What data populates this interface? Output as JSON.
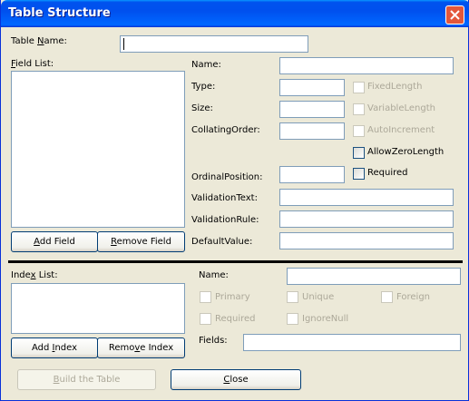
{
  "window": {
    "title": "Table Structure"
  },
  "table": {
    "name_label": "Table Name:",
    "name_value": ""
  },
  "field_list": {
    "label": "Field List:",
    "items": []
  },
  "field": {
    "name_label": "Name:",
    "name_value": "",
    "type_label": "Type:",
    "type_value": "",
    "size_label": "Size:",
    "size_value": "",
    "collating_label": "CollatingOrder:",
    "collating_value": "",
    "ordinal_label": "OrdinalPosition:",
    "ordinal_value": "",
    "validation_text_label": "ValidationText:",
    "validation_text_value": "",
    "validation_rule_label": "ValidationRule:",
    "validation_rule_value": "",
    "default_label": "DefaultValue:",
    "default_value": "",
    "fixed_length": "FixedLength",
    "variable_length": "VariableLength",
    "auto_increment": "AutoIncrement",
    "allow_zero_length": "AllowZeroLength",
    "required": "Required"
  },
  "buttons": {
    "add_field": "Add Field",
    "remove_field": "Remove Field",
    "add_index": "Add Index",
    "remove_index": "Remove Index",
    "build_table": "Build the Table",
    "close": "Close"
  },
  "index_list": {
    "label": "Index List:",
    "items": []
  },
  "index": {
    "name_label": "Name:",
    "name_value": "",
    "primary": "Primary",
    "unique": "Unique",
    "foreign": "Foreign",
    "required": "Required",
    "ignore_null": "IgnoreNull",
    "fields_label": "Fields:",
    "fields_value": ""
  },
  "checkbox_states": {
    "fixed_length": false,
    "variable_length": false,
    "auto_increment": false,
    "allow_zero_length": false,
    "required": false,
    "primary": false,
    "unique": false,
    "foreign": false,
    "index_required": false,
    "ignore_null": false
  },
  "icons": {
    "close": "close-x-icon"
  },
  "colors": {
    "titlebar": "#0053ee",
    "face": "#ece9d8",
    "close": "#e3573b",
    "input_border": "#7f9db9"
  }
}
